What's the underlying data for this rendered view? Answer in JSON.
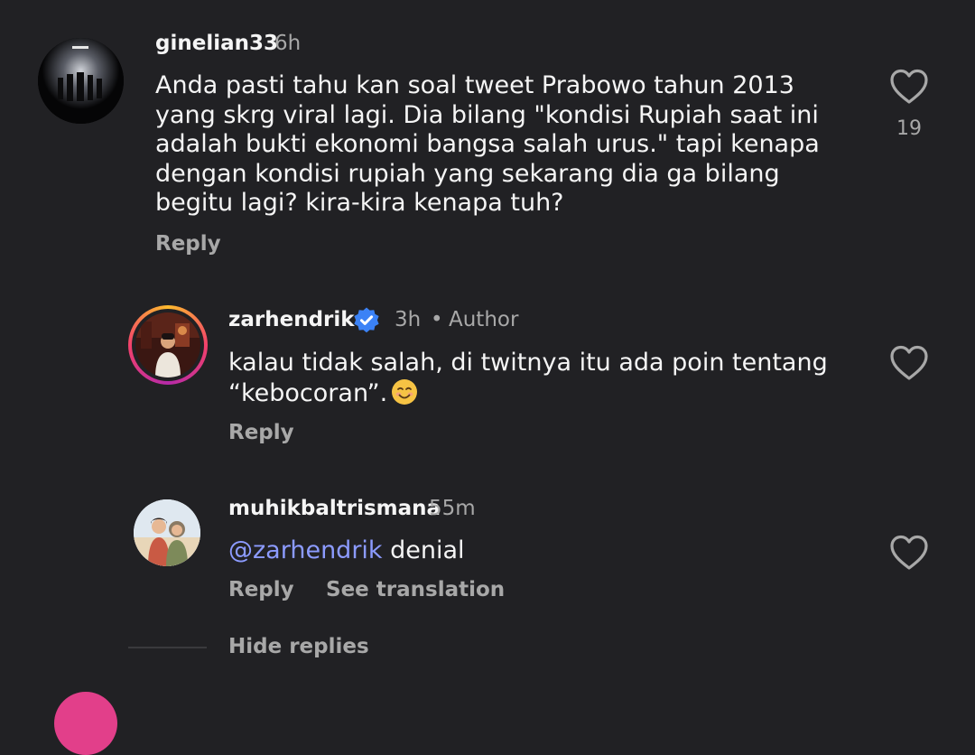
{
  "comments": [
    {
      "username": "ginelian33",
      "time": "6h",
      "text_lines": [
        "Anda pasti tahu kan soal tweet Prabowo tahun 2013",
        "yang skrg viral lagi. Dia bilang \"kondisi Rupiah saat ini",
        "adalah bukti ekonomi bangsa salah urus.\" tapi kenapa",
        "dengan kondisi rupiah yang sekarang dia ga bilang",
        "begitu lagi? kira-kira kenapa tuh?"
      ],
      "likes": "19",
      "reply_label": "Reply",
      "like_icon": "heart-outline-icon"
    },
    {
      "username": "zarhendrik",
      "verified_icon": "verified-badge-icon",
      "time": "3h",
      "separator": "•",
      "role": "Author",
      "text_lines": [
        "kalau tidak salah, di twitnya itu ada poin tentang",
        "“kebocoran”."
      ],
      "emoji": "smiling-face-emoji",
      "reply_label": "Reply",
      "like_icon": "heart-outline-icon"
    },
    {
      "username": "muhikbaltrismana",
      "time": "55m",
      "mention": "@zarhendrik",
      "text": " denial",
      "reply_label": "Reply",
      "translate_label": "See translation",
      "like_icon": "heart-outline-icon"
    }
  ],
  "hide_replies_label": "Hide replies",
  "colors": {
    "background": "#212124",
    "text": "#f5f5f5",
    "secondary": "#a8a8a8",
    "mention": "#8c9bff",
    "verified": "#3b82f6"
  }
}
